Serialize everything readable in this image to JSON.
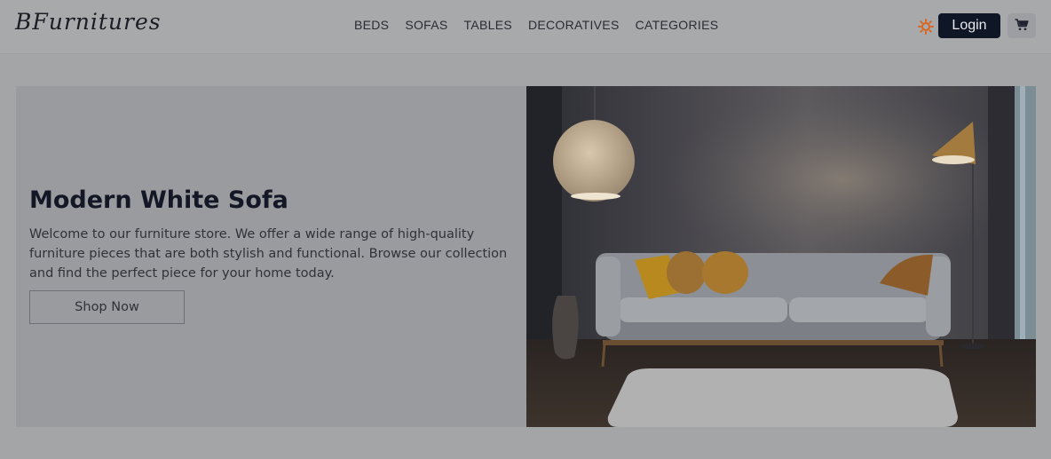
{
  "brand": {
    "logo": "BFurnitures"
  },
  "nav": {
    "items": [
      {
        "label": "BEDS"
      },
      {
        "label": "SOFAS"
      },
      {
        "label": "TABLES"
      },
      {
        "label": "DECORATIVES"
      },
      {
        "label": "CATEGORIES"
      }
    ]
  },
  "header": {
    "theme_icon": "sun-icon",
    "login_label": "Login",
    "cart_icon": "cart-icon"
  },
  "hero": {
    "title": "Modern White Sofa",
    "description": "Welcome to our furniture store. We offer a wide range of high-quality furniture pieces that are both stylish and functional. Browse our collection and find the perfect piece for your home today.",
    "cta_label": "Shop Now",
    "image": "sofa-living-room-image"
  },
  "colors": {
    "accent_sun": "#d9651e",
    "login_bg": "#0f1626",
    "overlay_bg": "#a4a5a7"
  }
}
